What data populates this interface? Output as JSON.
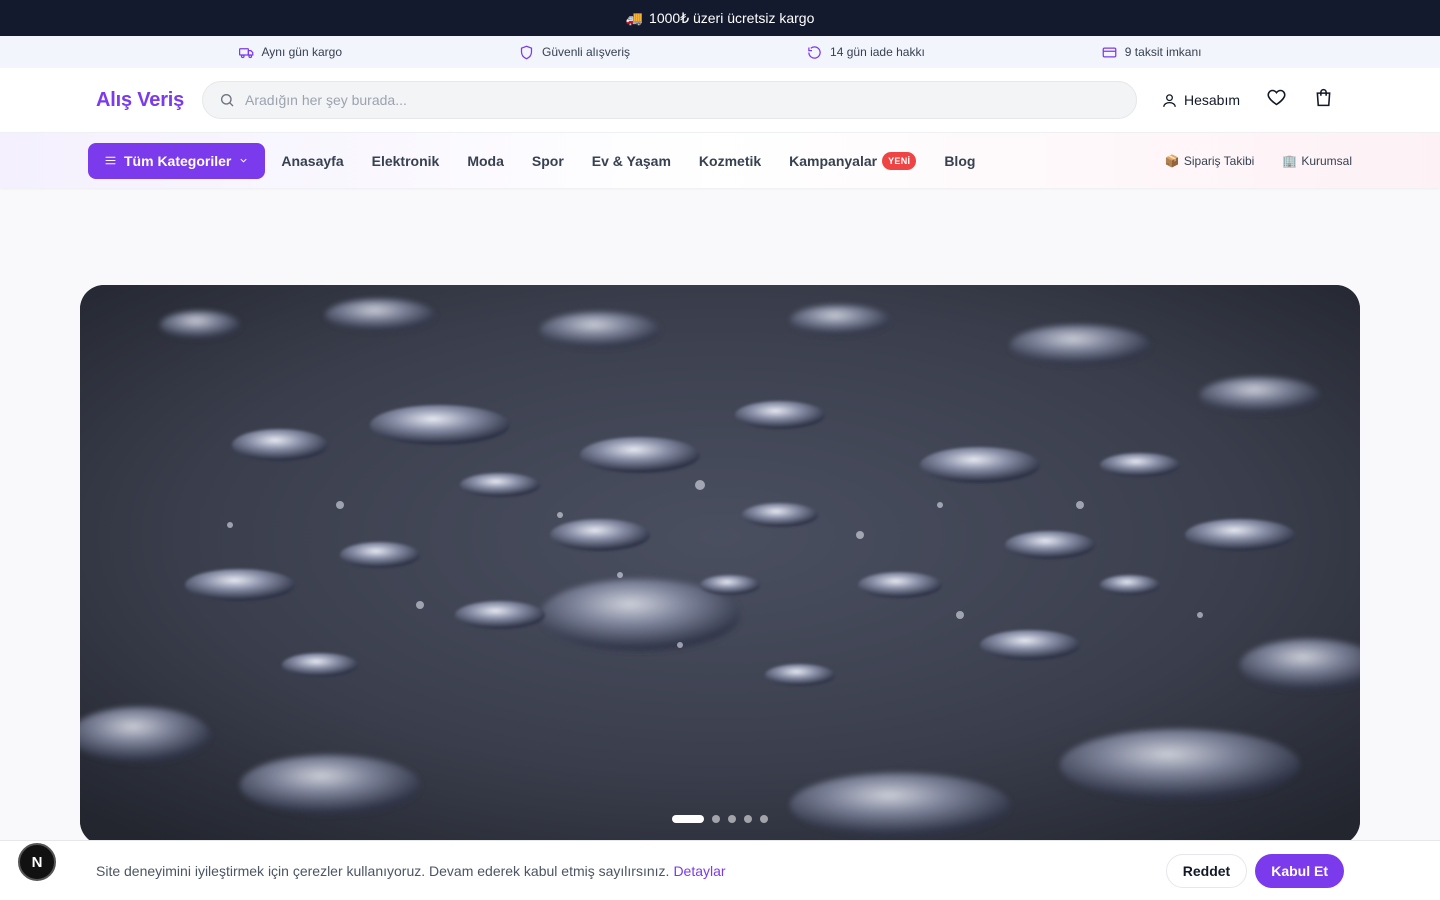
{
  "promo": {
    "icon": "truck-icon",
    "text": "1000₺ üzeri ücretsiz kargo"
  },
  "features": [
    {
      "icon": "truck-icon",
      "label": "Aynı gün kargo"
    },
    {
      "icon": "shield-icon",
      "label": "Güvenli alışveriş"
    },
    {
      "icon": "return-icon",
      "label": "14 gün iade hakkı"
    },
    {
      "icon": "card-icon",
      "label": "9 taksit imkanı"
    }
  ],
  "header": {
    "logo": "Alış Veriş",
    "search_placeholder": "Aradığın her şey burada...",
    "account_label": "Hesabım"
  },
  "nav": {
    "categories_label": "Tüm Kategoriler",
    "links": [
      "Anasayfa",
      "Elektronik",
      "Moda",
      "Spor",
      "Ev & Yaşam",
      "Kozmetik",
      "Kampanyalar",
      "Blog"
    ],
    "campaign_badge": "YENİ",
    "order_tracking": "Sipariş Takibi",
    "corporate": "Kurumsal"
  },
  "hero": {
    "slides": 5,
    "active_slide": 1
  },
  "cookie": {
    "message": "Site deneyimini iyileştirmek için çerezler kullanıyoruz. Devam ederek kabul etmiş sayılırsınız.",
    "details_link": "Detaylar",
    "reject_label": "Reddet",
    "accept_label": "Kabul Et"
  },
  "dev_badge": "N",
  "colors": {
    "accent": "#7c3aed",
    "promo_bg": "#141a2e",
    "badge": "#ef4444"
  }
}
